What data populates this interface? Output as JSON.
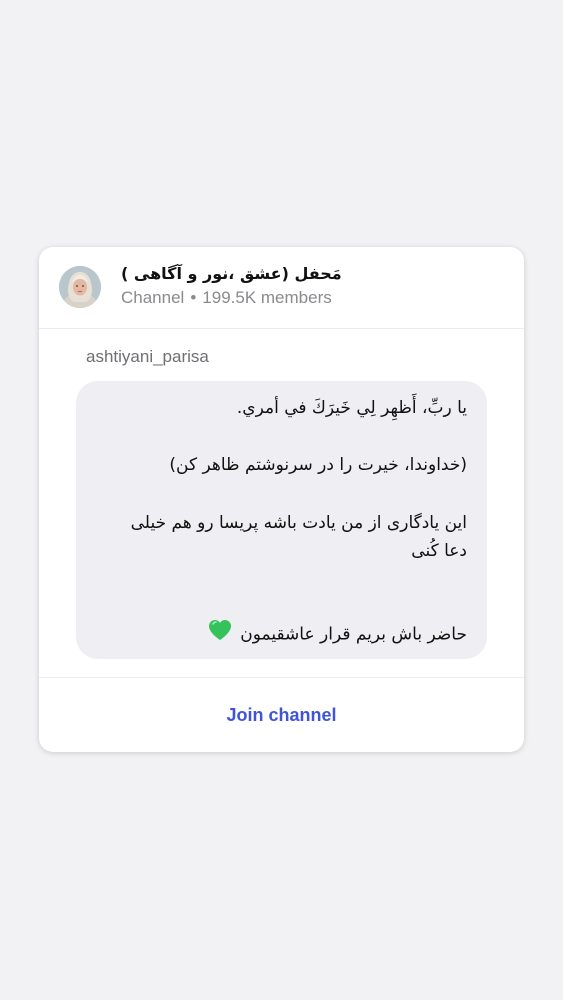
{
  "channel": {
    "name": "مَحفل   (عشق ،نور و آگاهی  )",
    "type": "Channel",
    "separator": "•",
    "members": "199.5K members"
  },
  "post": {
    "author": "ashtiyani_parisa",
    "lines": [
      "يا ربِّ، أَظهِر لِي خَيرَكَ في أمري.",
      "(خداوندا، خیرت را در سرنوشتم ظاهر کن)",
      "این یادگاری از من یادت باشه پریسا رو هم خیلی",
      "دعا کُنی",
      "حاضر باش بریم قرار عاشقیمون"
    ],
    "heart_icon": "green-heart-icon",
    "heart_color": "#35c25a"
  },
  "actions": {
    "join_label": "Join channel",
    "accent_color": "#3f55d6"
  }
}
